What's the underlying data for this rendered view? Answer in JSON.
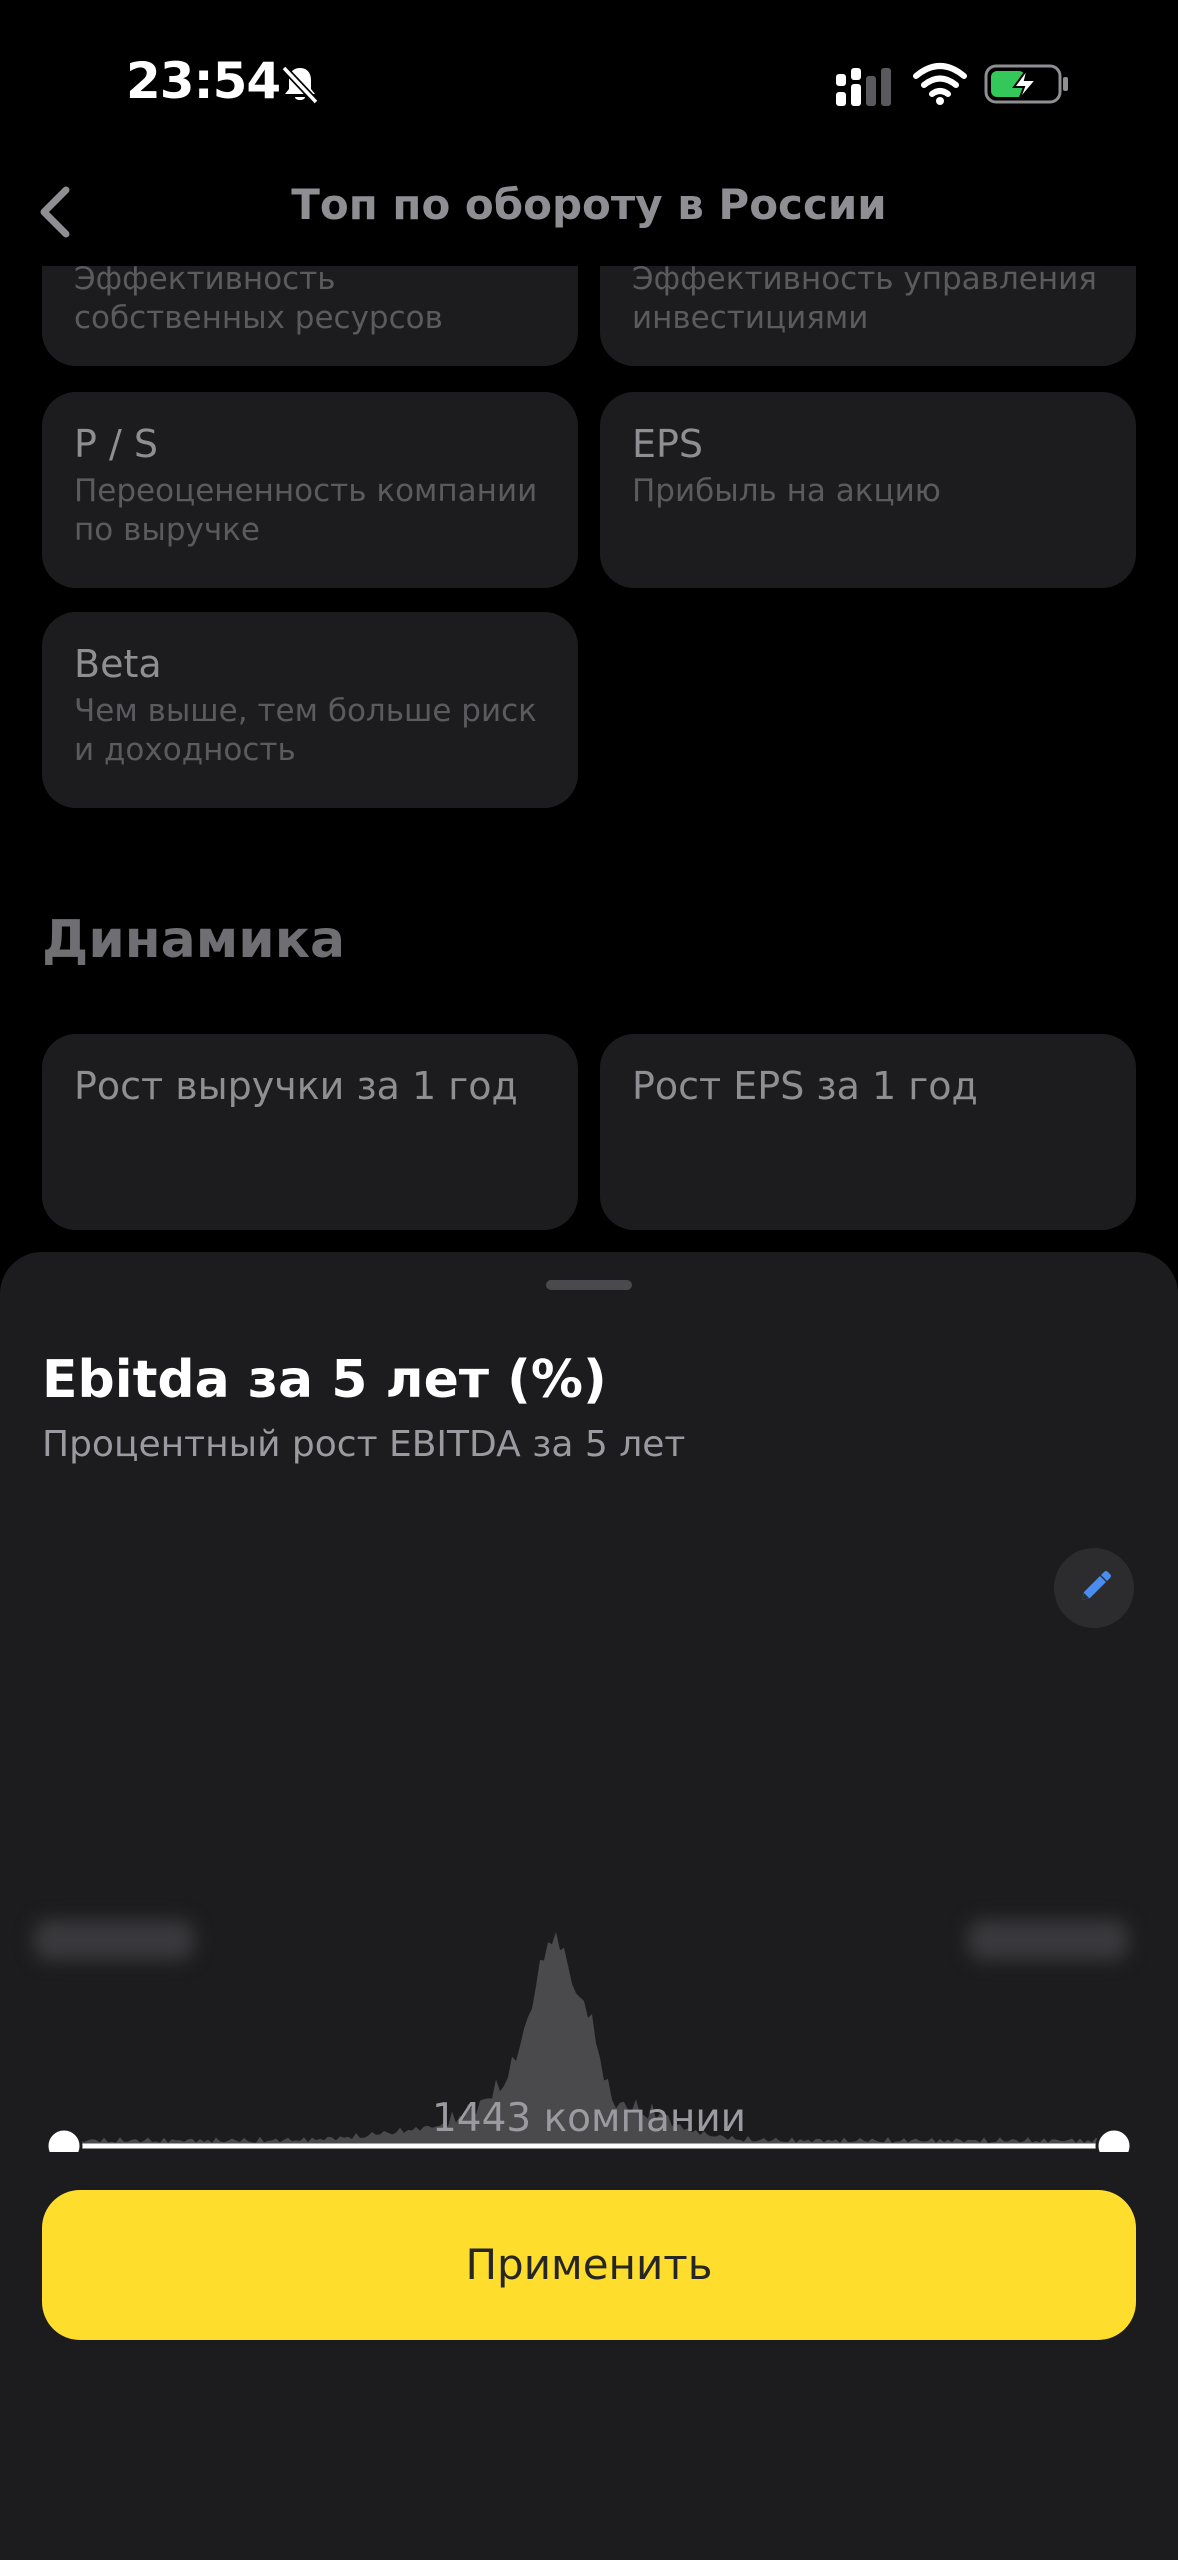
{
  "status_bar": {
    "time": "23:54"
  },
  "header": {
    "title": "Топ по обороту в России"
  },
  "metric_cards": [
    {
      "title": "",
      "desc": "Эффективность собственных ресурсов"
    },
    {
      "title": "",
      "desc": "Эффективность управления инвестициями"
    },
    {
      "title": "P / S",
      "desc": "Переоцененность компании по выручке"
    },
    {
      "title": "EPS",
      "desc": "Прибыль на акцию"
    },
    {
      "title": "Beta",
      "desc": "Чем выше, тем больше риск и доходность"
    }
  ],
  "dynamics": {
    "section_title": "Динамика",
    "cards": [
      {
        "title": "Рост выручки за 1 год"
      },
      {
        "title": "Рост EPS за 1 год"
      }
    ]
  },
  "sheet": {
    "title": "Ebitda за 5 лет (%)",
    "subtitle": "Процентный рост EBITDA за 5 лет",
    "companies_count": "1443 компании",
    "apply_label": "Применить",
    "range_selected": [
      0,
      1
    ]
  },
  "icons": {
    "back": "chevron-left-icon",
    "edit": "pencil-icon",
    "bell": "bell-slash-icon",
    "signal": "cellular-signal-icon",
    "wifi": "wifi-icon",
    "battery": "battery-charging-icon"
  },
  "colors": {
    "background": "#000000",
    "card": "#1c1c1e",
    "sheet": "#1c1c1e",
    "accent_yellow": "#fedd2c",
    "edit_icon_blue": "#4a8cf0",
    "battery_green": "#34c759",
    "histogram_fill": "#4a4a4c"
  }
}
